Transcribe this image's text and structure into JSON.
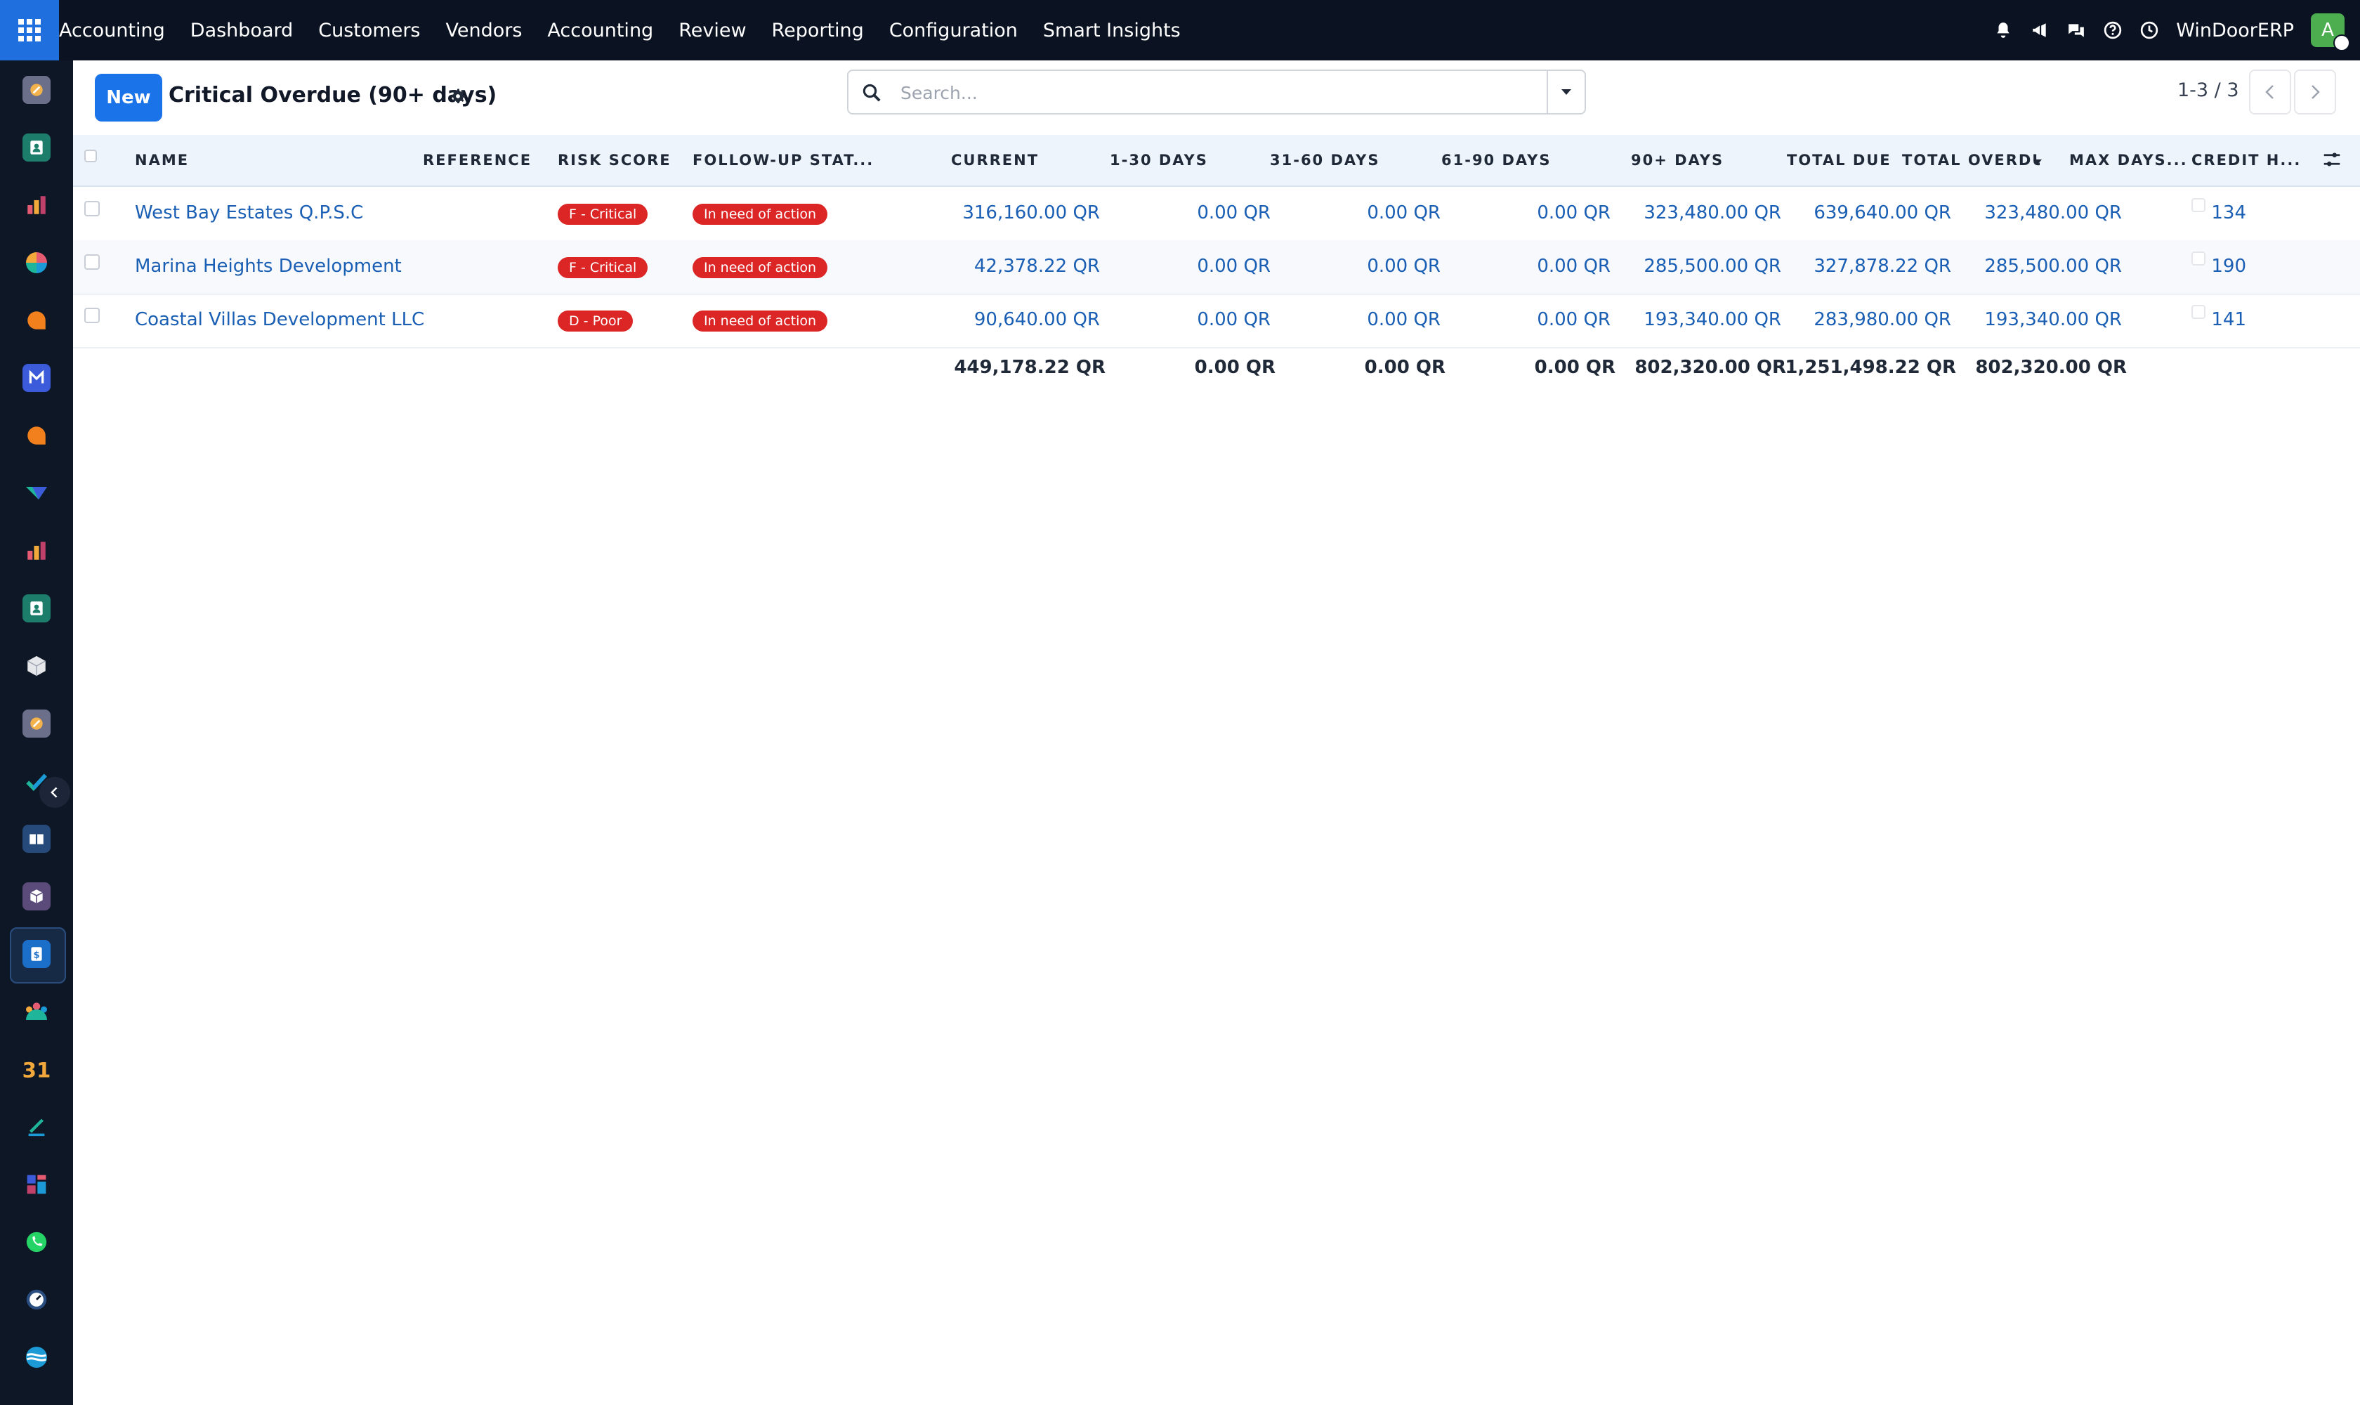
{
  "topbar": {
    "app_name": "Accounting",
    "nav": [
      "Dashboard",
      "Customers",
      "Vendors",
      "Accounting",
      "Review",
      "Reporting",
      "Configuration",
      "Smart Insights"
    ],
    "company": "WinDoorERP",
    "avatar_letter": "A"
  },
  "sidebar": {
    "apps": [
      "discuss-icon",
      "contacts-icon",
      "reporting-icon",
      "dashboards-icon",
      "live-chat-icon",
      "email-marketing-icon",
      "helpdesk-icon",
      "documents-icon",
      "spreadsheet-icon",
      "employees-icon",
      "inventory-icon",
      "knowledge-icon",
      "project-icon",
      "studio-icon",
      "barcode-icon",
      "invoicing-icon",
      "team-icon",
      "calendar-icon",
      "sign-icon",
      "apps-icon",
      "whatsapp-icon",
      "timer-icon",
      "website-icon"
    ],
    "active_app": "invoicing-icon"
  },
  "control_panel": {
    "new_label": "New",
    "title": "Critical Overdue (90+ days)",
    "search_placeholder": "Search...",
    "pager": "1-3 / 3"
  },
  "table": {
    "columns": [
      "NAME",
      "REFERENCE",
      "RISK SCORE",
      "FOLLOW-UP STAT...",
      "CURRENT",
      "1-30 DAYS",
      "31-60 DAYS",
      "61-90 DAYS",
      "90+ DAYS",
      "TOTAL DUE",
      "TOTAL OVERDUI",
      "MAX DAYS...",
      "CREDIT H..."
    ],
    "rows": [
      {
        "name": "West Bay Estates Q.P.S.C",
        "reference": "",
        "risk": "F - Critical",
        "followup": "In need of action",
        "current": "316,160.00 QR",
        "d1_30": "0.00 QR",
        "d31_60": "0.00 QR",
        "d61_90": "0.00 QR",
        "d90": "323,480.00 QR",
        "total_due": "639,640.00 QR",
        "total_overdue": "323,480.00 QR",
        "max_days": "134"
      },
      {
        "name": "Marina Heights Development",
        "reference": "",
        "risk": "F - Critical",
        "followup": "In need of action",
        "current": "42,378.22 QR",
        "d1_30": "0.00 QR",
        "d31_60": "0.00 QR",
        "d61_90": "0.00 QR",
        "d90": "285,500.00 QR",
        "total_due": "327,878.22 QR",
        "total_overdue": "285,500.00 QR",
        "max_days": "190"
      },
      {
        "name": "Coastal Villas Development LLC",
        "reference": "",
        "risk": "D - Poor",
        "followup": "In need of action",
        "current": "90,640.00 QR",
        "d1_30": "0.00 QR",
        "d31_60": "0.00 QR",
        "d61_90": "0.00 QR",
        "d90": "193,340.00 QR",
        "total_due": "283,980.00 QR",
        "total_overdue": "193,340.00 QR",
        "max_days": "141"
      }
    ],
    "totals": {
      "current": "449,178.22 QR",
      "d1_30": "0.00 QR",
      "d31_60": "0.00 QR",
      "d61_90": "0.00 QR",
      "d90": "802,320.00 QR",
      "total_due": "1,251,498.22 QR",
      "total_overdue": "802,320.00 QR"
    }
  },
  "colors": {
    "accent": "#1a73e8",
    "topbar": "#0b1221",
    "sidebar": "#0e1726",
    "badge": "#dc2626",
    "link": "#1a5fb4"
  }
}
